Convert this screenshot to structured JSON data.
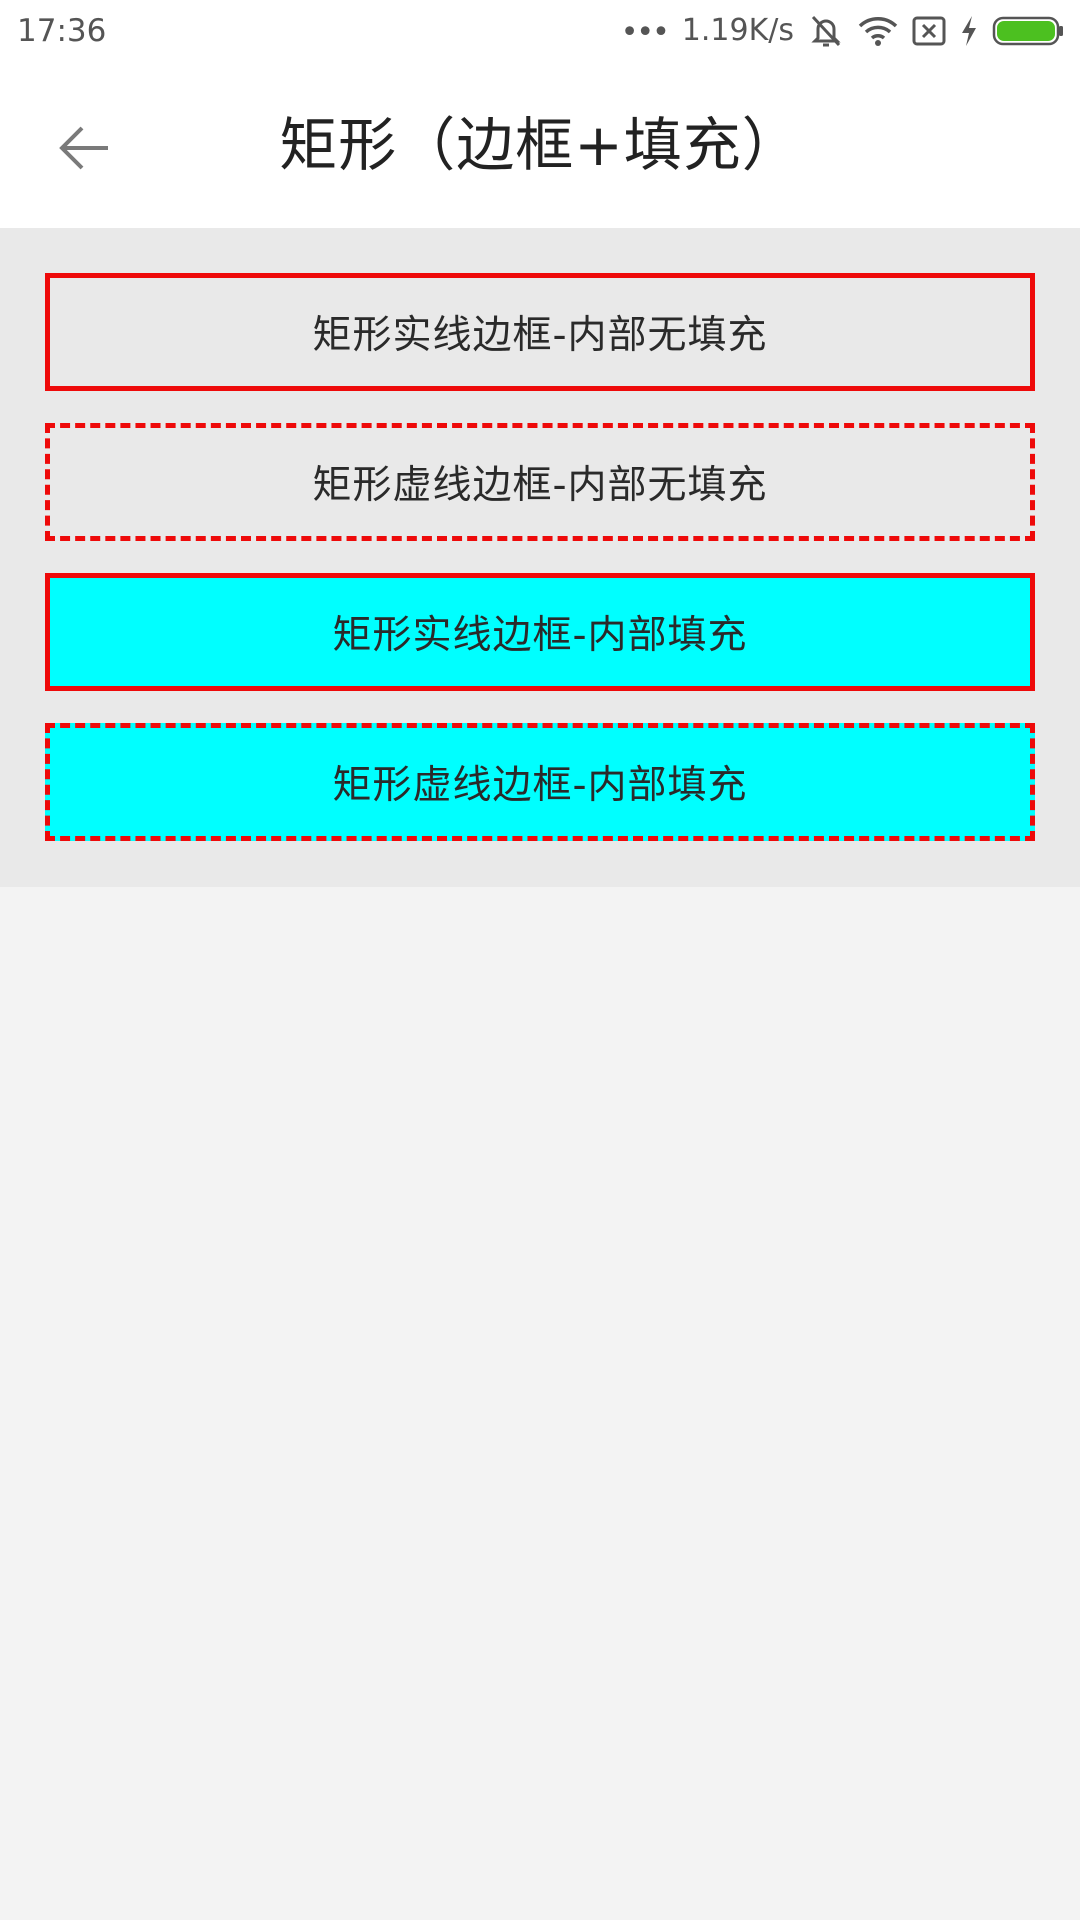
{
  "status_bar": {
    "time": "17:36",
    "dots": "•••",
    "network_speed": "1.19K/s",
    "icons": [
      "mute-icon",
      "wifi-icon",
      "no-sim-icon",
      "charging-icon",
      "battery-icon"
    ],
    "battery_color": "#4cc020"
  },
  "app_bar": {
    "back_icon": "arrow-left-icon",
    "title": "矩形（边框+填充）"
  },
  "rectangles": [
    {
      "label": "矩形实线边框-内部无填充",
      "border_style": "solid",
      "border_color": "#ee0a0a",
      "fill": "none"
    },
    {
      "label": "矩形虚线边框-内部无填充",
      "border_style": "dashed",
      "border_color": "#ee0a0a",
      "fill": "none"
    },
    {
      "label": "矩形实线边框-内部填充",
      "border_style": "solid",
      "border_color": "#ee0a0a",
      "fill": "#00ffff"
    },
    {
      "label": "矩形虚线边框-内部填充",
      "border_style": "dashed",
      "border_color": "#ee0a0a",
      "fill": "#00ffff"
    }
  ]
}
